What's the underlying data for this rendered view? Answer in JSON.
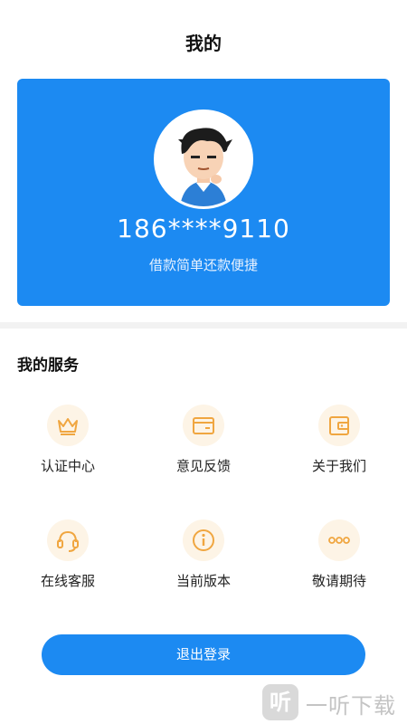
{
  "header": {
    "title": "我的"
  },
  "profile": {
    "phone": "186****9110",
    "slogan": "借款简单还款便捷",
    "avatar_icon": "avatar-cartoon-boy"
  },
  "services": {
    "title": "我的服务",
    "items": [
      {
        "label": "认证中心",
        "icon": "crown-icon"
      },
      {
        "label": "意见反馈",
        "icon": "card-icon"
      },
      {
        "label": "关于我们",
        "icon": "wallet-icon"
      },
      {
        "label": "在线客服",
        "icon": "headset-icon"
      },
      {
        "label": "当前版本",
        "icon": "info-icon"
      },
      {
        "label": "敬请期待",
        "icon": "more-dots-icon"
      }
    ]
  },
  "actions": {
    "logout_label": "退出登录"
  },
  "watermark": {
    "badge": "听",
    "text": "一听下载"
  },
  "colors": {
    "primary": "#1c8af2",
    "icon_accent": "#f0a640",
    "icon_bg": "#fdf4e6"
  }
}
